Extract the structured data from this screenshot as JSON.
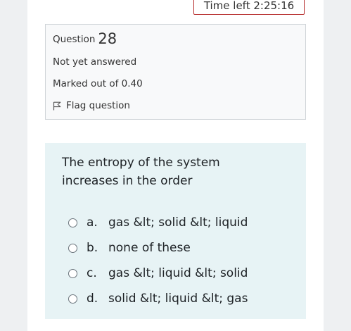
{
  "timer": {
    "label": "Time left 2:25:16"
  },
  "question_info": {
    "question_label": "Question",
    "question_number": "28",
    "state": "Not yet answered",
    "grade": "Marked out of 0.40",
    "flag_label": "Flag question"
  },
  "question": {
    "text_line1": "The entropy of the system",
    "text_line2": "increases in the order"
  },
  "answers": [
    {
      "letter": "a.",
      "text": "gas &lt; solid &lt; liquid"
    },
    {
      "letter": "b.",
      "text": "none of these"
    },
    {
      "letter": "c.",
      "text": "gas &lt; liquid &lt; solid"
    },
    {
      "letter": "d.",
      "text": "solid &lt; liquid &lt; gas"
    }
  ],
  "colors": {
    "timer_border": "#b52a2a",
    "info_background": "#f8f9fa",
    "formulation_background": "#e7f3f5"
  }
}
